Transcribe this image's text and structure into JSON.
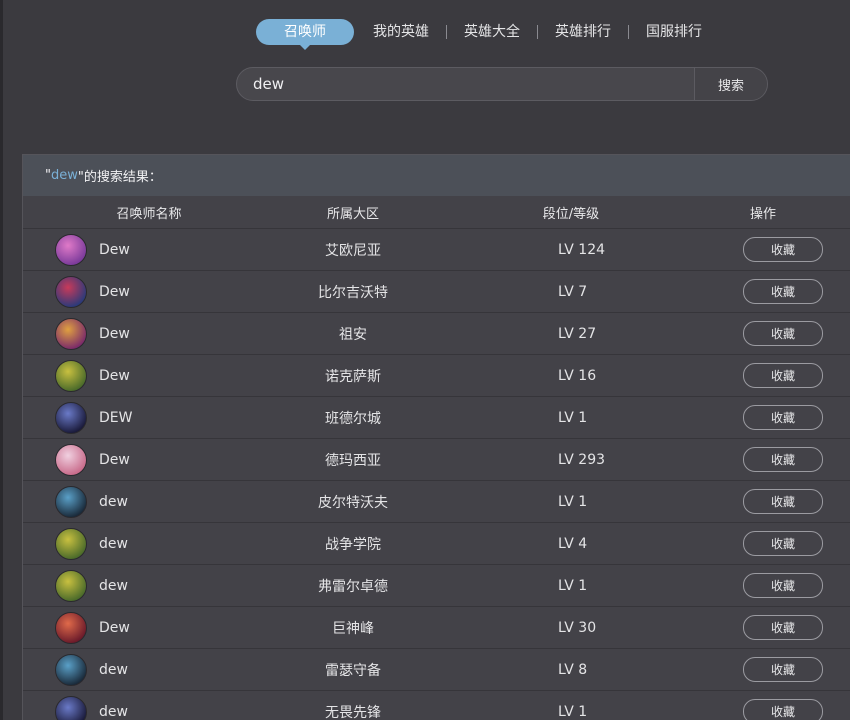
{
  "nav": {
    "tabs": [
      {
        "label": "召唤师",
        "active": true
      },
      {
        "label": "我的英雄",
        "active": false
      },
      {
        "label": "英雄大全",
        "active": false
      },
      {
        "label": "英雄排行",
        "active": false
      },
      {
        "label": "国服排行",
        "active": false
      }
    ]
  },
  "search": {
    "value": "dew",
    "button_label": "搜索"
  },
  "results": {
    "title_open_quote": "\"",
    "keyword": "dew",
    "title_suffix": "\"的搜索结果：",
    "columns": {
      "name": "召唤师名称",
      "server": "所属大区",
      "level": "段位/等级",
      "action": "操作"
    },
    "action_label": "收藏",
    "rows": [
      {
        "name": "Dew",
        "server": "艾欧尼亚",
        "level": "LV 124",
        "avatar_colors": [
          "#e07ac8",
          "#7a3a9a"
        ]
      },
      {
        "name": "Dew",
        "server": "比尔吉沃特",
        "level": "LV 7",
        "avatar_colors": [
          "#c83a5a",
          "#2a3a7a"
        ]
      },
      {
        "name": "Dew",
        "server": "祖安",
        "level": "LV 27",
        "avatar_colors": [
          "#e0a040",
          "#7a2a6a"
        ]
      },
      {
        "name": "Dew",
        "server": "诺克萨斯",
        "level": "LV 16",
        "avatar_colors": [
          "#c8c040",
          "#4a6a2a"
        ]
      },
      {
        "name": "DEW",
        "server": "班德尔城",
        "level": "LV 1",
        "avatar_colors": [
          "#6a7ac8",
          "#1a1a3a"
        ]
      },
      {
        "name": "Dew",
        "server": "德玛西亚",
        "level": "LV 293",
        "avatar_colors": [
          "#f0d0e0",
          "#c86a8a"
        ]
      },
      {
        "name": "dew",
        "server": "皮尔特沃夫",
        "level": "LV 1",
        "avatar_colors": [
          "#5aa0c8",
          "#1a2a3a"
        ]
      },
      {
        "name": "dew",
        "server": "战争学院",
        "level": "LV 4",
        "avatar_colors": [
          "#c8c040",
          "#4a6a2a"
        ]
      },
      {
        "name": "dew",
        "server": "弗雷尔卓德",
        "level": "LV 1",
        "avatar_colors": [
          "#c8c040",
          "#4a6a2a"
        ]
      },
      {
        "name": "Dew",
        "server": "巨神峰",
        "level": "LV 30",
        "avatar_colors": [
          "#e06a4a",
          "#6a1a2a"
        ]
      },
      {
        "name": "dew",
        "server": "雷瑟守备",
        "level": "LV 8",
        "avatar_colors": [
          "#5aa0c8",
          "#1a2a3a"
        ]
      },
      {
        "name": "dew",
        "server": "无畏先锋",
        "level": "LV 1",
        "avatar_colors": [
          "#6a7ac8",
          "#1a1a3a"
        ]
      }
    ]
  }
}
